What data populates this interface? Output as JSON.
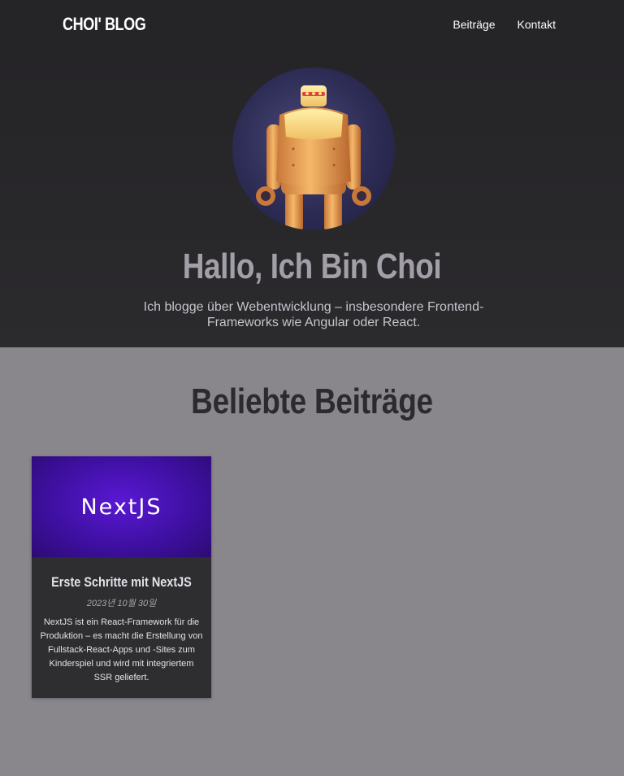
{
  "header": {
    "logo": "CHOI' BLOG",
    "nav": [
      "Beiträge",
      "Kontakt"
    ]
  },
  "hero": {
    "title": "Hallo, Ich Bin Choi",
    "text": "Ich blogge über Webentwicklung – insbesondere Frontend-Frameworks wie Angular oder React."
  },
  "featured": {
    "title": "Beliebte Beiträge",
    "posts": [
      {
        "image_text": "NextJS",
        "title": "Erste Schritte mit NextJS",
        "date": "2023년 10월 30일",
        "excerpt": "NextJS ist ein React-Framework für die Produktion – es macht die Erstellung von Fullstack-React-Apps und -Sites zum Kinderspiel und wird mit integriertem SSR geliefert."
      }
    ]
  },
  "colors": {
    "header_bg": "#252427",
    "page_bg": "#89868c",
    "card_bg": "#2e2d30",
    "nextjs_purple": "#4a12b8"
  }
}
